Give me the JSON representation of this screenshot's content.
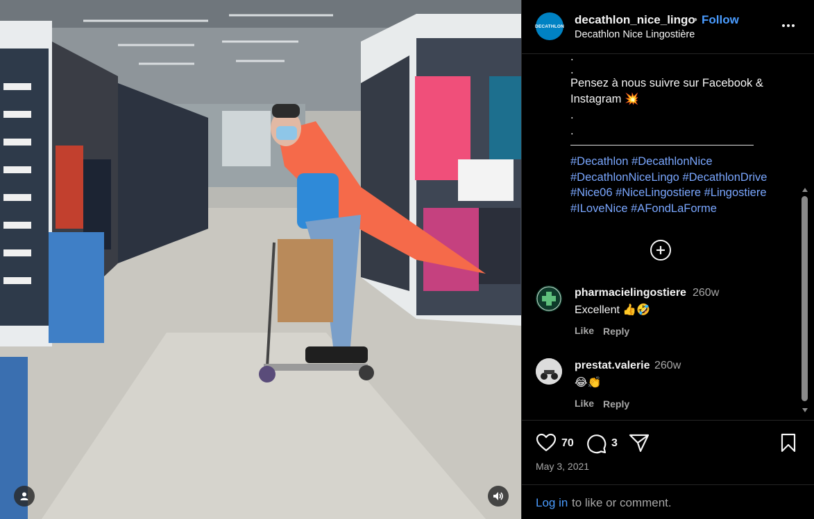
{
  "post": {
    "username": "decathlon_nice_lingo",
    "separator": "•",
    "follow_label": "Follow",
    "location": "Decathlon Nice Lingostière",
    "avatar_text": "DECATHLON"
  },
  "caption": {
    "lines": [
      ".",
      ".",
      "Pensez à nous suivre sur Facebook &",
      "Instagram 💥",
      ".",
      "."
    ],
    "hashtag_lines": [
      "#Decathlon #DecathlonNice",
      "#DecathlonNiceLingo #DecathlonDrive",
      "#Nice06 #NiceLingostiere #Lingostiere",
      "#ILoveNice #AFondLaForme"
    ]
  },
  "comments": [
    {
      "username": "pharmacielingostiere",
      "time": "260w",
      "text": "Excellent 👍🤣",
      "like_label": "Like",
      "reply_label": "Reply"
    },
    {
      "username": "prestat.valerie",
      "time": "260w",
      "text": "😂👏",
      "like_label": "Like",
      "reply_label": "Reply"
    }
  ],
  "actions": {
    "likes_count": "70",
    "comments_count": "3",
    "date": "May 3, 2021"
  },
  "login": {
    "link_label": "Log in",
    "rest_text": "to like or comment."
  },
  "icons": {
    "more": "more-options-icon",
    "load_more": "plus-circle-icon",
    "like": "heart-icon",
    "comment": "comment-icon",
    "share": "share-icon",
    "save": "bookmark-icon",
    "tag": "user-tag-icon",
    "audio": "speaker-icon"
  },
  "colors": {
    "background": "#000000",
    "link": "#4a9cff",
    "hashtag": "#7aa7ff",
    "muted": "#a8a8a8",
    "brand": "#0082c3"
  }
}
